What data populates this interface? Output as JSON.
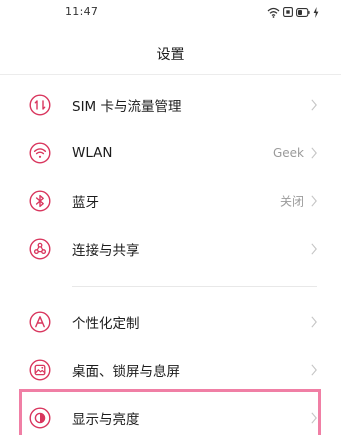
{
  "status_bar": {
    "time": "11:47",
    "icons": [
      "wifi-icon",
      "nfc-icon",
      "battery-icon",
      "charging-icon"
    ]
  },
  "header": {
    "title": "设置"
  },
  "groups": [
    {
      "items": [
        {
          "label": "SIM 卡与流量管理",
          "value": "",
          "icon": "sim-data-icon"
        },
        {
          "label": "WLAN",
          "value": "Geek",
          "icon": "wifi-icon"
        },
        {
          "label": "蓝牙",
          "value": "关闭",
          "icon": "bluetooth-icon"
        },
        {
          "label": "连接与共享",
          "value": "",
          "icon": "connection-share-icon"
        }
      ]
    },
    {
      "items": [
        {
          "label": "个性化定制",
          "value": "",
          "icon": "personalization-icon"
        },
        {
          "label": "桌面、锁屏与息屏",
          "value": "",
          "icon": "desktop-lockscreen-icon"
        },
        {
          "label": "显示与亮度",
          "value": "",
          "icon": "display-brightness-icon"
        }
      ]
    }
  ],
  "colors": {
    "icon_accent": "#d9365e",
    "highlight": "#f07fa5",
    "chevron": "#c4c4c4"
  }
}
